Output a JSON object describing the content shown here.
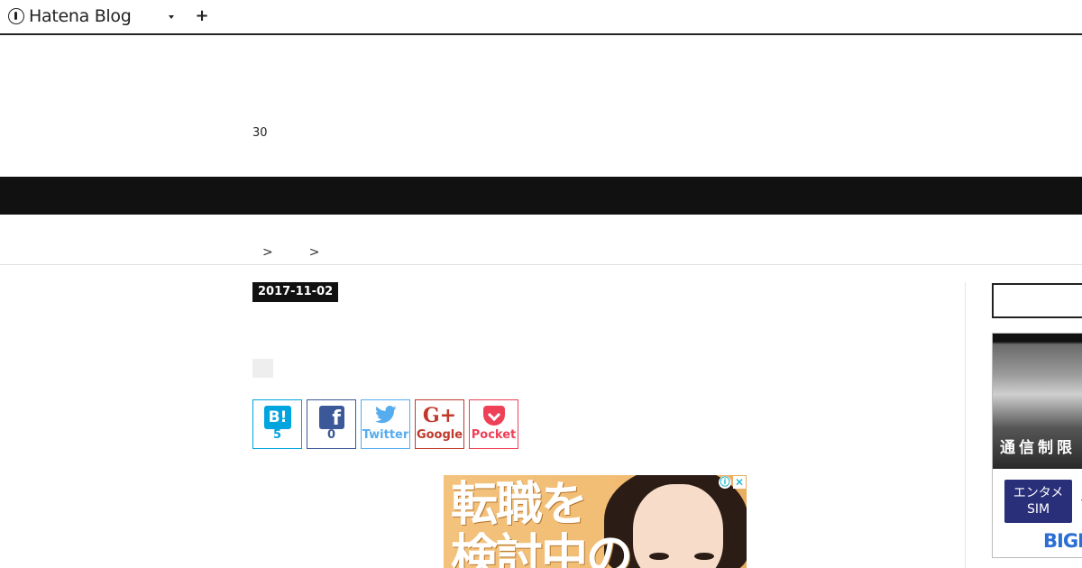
{
  "topbar": {
    "logo_text": "Hatena Blog",
    "logo_icon": "hatena-logo-icon",
    "menu_icon": "caret-down-icon",
    "add_icon": "plus-icon",
    "add_label": "+"
  },
  "header": {
    "description": "30"
  },
  "breadcrumb": {
    "sep1": ">",
    "sep2": ">"
  },
  "article": {
    "date": "2017-11-02"
  },
  "share": {
    "hatena": {
      "icon_text": "B!",
      "count": "5",
      "color": "#00a4de"
    },
    "facebook": {
      "icon_text": "f",
      "count": "0",
      "color": "#3b5998"
    },
    "twitter": {
      "label": "Twitter",
      "color": "#55acee"
    },
    "google": {
      "icon_text": "G+",
      "label": "Google",
      "color": "#c0392b"
    },
    "pocket": {
      "label": "Pocket",
      "color": "#ee4056"
    }
  },
  "ad": {
    "headline_line1": "転職を",
    "headline_line2": "検討中の",
    "info_icon": "ⓘ",
    "close_icon": "✕"
  },
  "sidebar_ad": {
    "photo_caption": "通信制限",
    "button_label_line1": "エンタメ",
    "button_label_line2": "SIM",
    "brand": "BIGL"
  }
}
